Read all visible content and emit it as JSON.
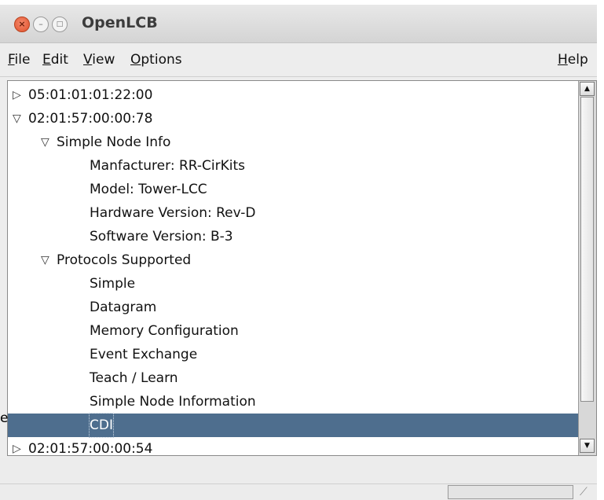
{
  "window": {
    "title": "OpenLCB",
    "controls": {
      "close": "×",
      "minimize": "–",
      "maximize": "□"
    }
  },
  "menubar": {
    "left": [
      {
        "label": "File",
        "mnemonic": "F",
        "rest": "ile"
      },
      {
        "label": "Edit",
        "mnemonic": "E",
        "rest": "dit"
      },
      {
        "label": "View",
        "mnemonic": "V",
        "rest": "iew"
      },
      {
        "label": "Options",
        "mnemonic": "O",
        "rest": "ptions"
      }
    ],
    "right": {
      "label": "Help",
      "mnemonic": "H",
      "rest": "elp"
    }
  },
  "tree": {
    "rows": [
      {
        "label": "05:01:01:01:22:00",
        "level": 0,
        "expander": "collapsed"
      },
      {
        "label": "02:01:57:00:00:78",
        "level": 0,
        "expander": "expanded"
      },
      {
        "label": "Simple Node Info",
        "level": 1,
        "expander": "expanded"
      },
      {
        "label": "Manfacturer: RR-CirKits",
        "level": 2,
        "expander": "none"
      },
      {
        "label": "Model: Tower-LCC",
        "level": 2,
        "expander": "none"
      },
      {
        "label": "Hardware Version: Rev-D",
        "level": 2,
        "expander": "none"
      },
      {
        "label": "Software Version: B-3",
        "level": 2,
        "expander": "none"
      },
      {
        "label": "Protocols Supported",
        "level": 1,
        "expander": "expanded"
      },
      {
        "label": "Simple",
        "level": 2,
        "expander": "none"
      },
      {
        "label": "Datagram",
        "level": 2,
        "expander": "none"
      },
      {
        "label": "Memory Configuration",
        "level": 2,
        "expander": "none"
      },
      {
        "label": "Event Exchange",
        "level": 2,
        "expander": "none"
      },
      {
        "label": "Teach / Learn",
        "level": 2,
        "expander": "none"
      },
      {
        "label": "Simple Node Information",
        "level": 2,
        "expander": "none"
      },
      {
        "label": "CDI",
        "level": 2,
        "expander": "none",
        "selected": true
      },
      {
        "label": "02:01:57:00:00:54",
        "level": 0,
        "expander": "collapsed"
      }
    ],
    "scrollbar": {
      "up": "▲",
      "down": "▼"
    }
  },
  "stray_text": "e",
  "icons": {
    "collapsed": "triangle-right-icon",
    "expanded": "triangle-down-icon",
    "resize": "resize-grip-icon"
  },
  "colors": {
    "selection": "#4e6e8e",
    "close_button": "#e0502b"
  }
}
